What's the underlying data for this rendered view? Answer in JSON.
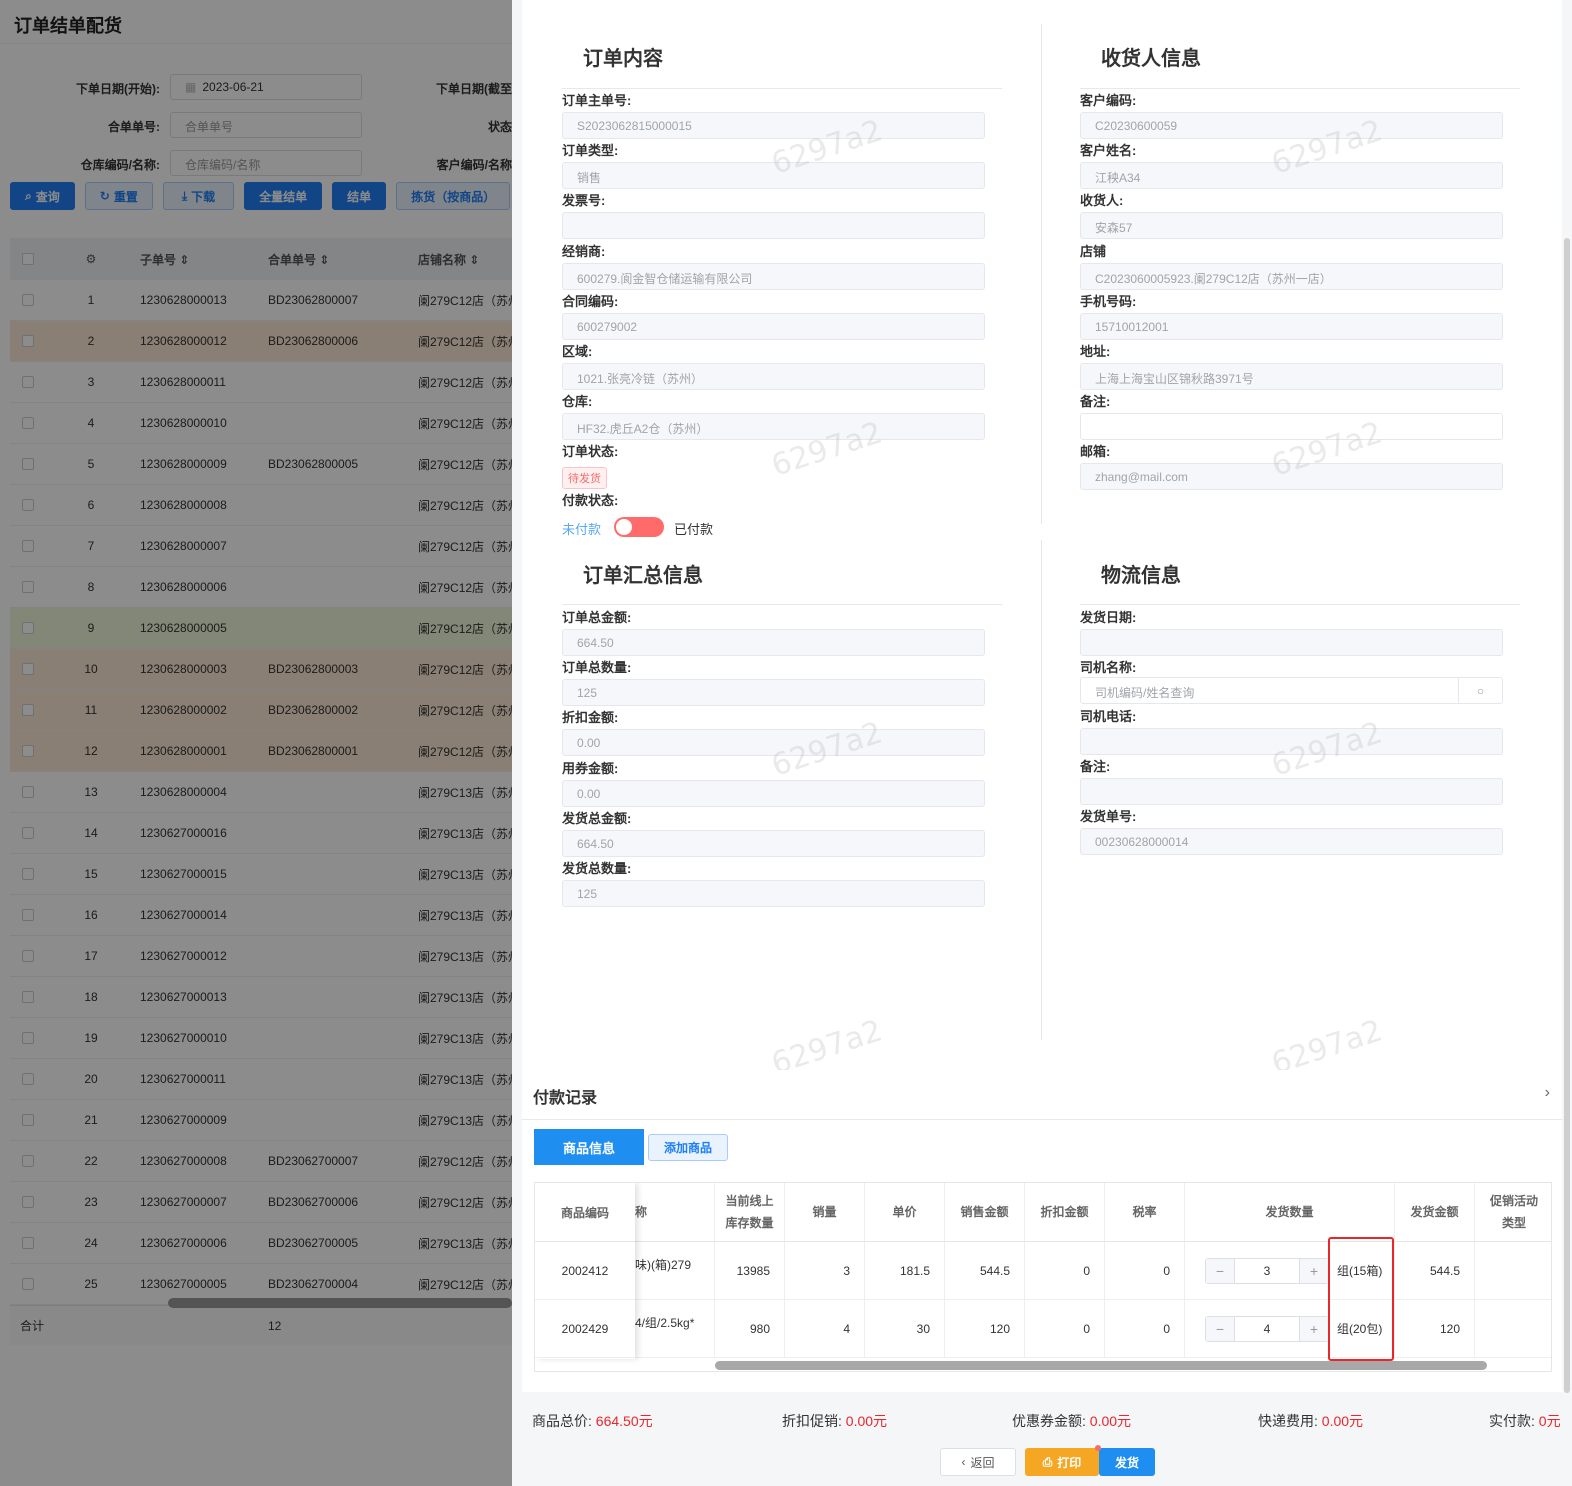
{
  "bg": {
    "title": "订单结单配货",
    "filters": {
      "start_label": "下单日期(开始):",
      "start_value": "2023-06-21",
      "end_label": "下单日期(截至",
      "merge_label": "合单单号:",
      "merge_placeholder": "合单单号",
      "status_label": "状态",
      "warehouse_label": "仓库编码/名称:",
      "warehouse_placeholder": "仓库编码/名称",
      "customer_label": "客户编码/名称"
    },
    "buttons": {
      "query": "查询",
      "reset": "重置",
      "download": "下载",
      "all_close": "全量结单",
      "close": "结单",
      "pick": "拣货（按商品）"
    },
    "columns": {
      "sub_no": "子单号",
      "merge_no": "合单单号",
      "shop": "店铺名称"
    },
    "rows": [
      {
        "idx": "1",
        "no": "1230628000013",
        "merge": "BD23062800007",
        "shop": "阑279C12店（苏州",
        "hl": ""
      },
      {
        "idx": "2",
        "no": "1230628000012",
        "merge": "BD23062800006",
        "shop": "阑279C12店（苏州",
        "hl": "o"
      },
      {
        "idx": "3",
        "no": "1230628000011",
        "merge": "",
        "shop": "阑279C12店（苏州",
        "hl": ""
      },
      {
        "idx": "4",
        "no": "1230628000010",
        "merge": "",
        "shop": "阑279C12店（苏州",
        "hl": ""
      },
      {
        "idx": "5",
        "no": "1230628000009",
        "merge": "BD23062800005",
        "shop": "阑279C12店（苏州",
        "hl": ""
      },
      {
        "idx": "6",
        "no": "1230628000008",
        "merge": "",
        "shop": "阑279C12店（苏州",
        "hl": ""
      },
      {
        "idx": "7",
        "no": "1230628000007",
        "merge": "",
        "shop": "阑279C12店（苏州",
        "hl": ""
      },
      {
        "idx": "8",
        "no": "1230628000006",
        "merge": "",
        "shop": "阑279C12店（苏州",
        "hl": ""
      },
      {
        "idx": "9",
        "no": "1230628000005",
        "merge": "",
        "shop": "阑279C12店（苏州",
        "hl": "g"
      },
      {
        "idx": "10",
        "no": "1230628000003",
        "merge": "BD23062800003",
        "shop": "阑279C12店（苏州",
        "hl": "o"
      },
      {
        "idx": "11",
        "no": "1230628000002",
        "merge": "BD23062800002",
        "shop": "阑279C12店（苏州",
        "hl": "o"
      },
      {
        "idx": "12",
        "no": "1230628000001",
        "merge": "BD23062800001",
        "shop": "阑279C12店（苏州",
        "hl": "o"
      },
      {
        "idx": "13",
        "no": "1230628000004",
        "merge": "",
        "shop": "阑279C13店（苏州",
        "hl": ""
      },
      {
        "idx": "14",
        "no": "1230627000016",
        "merge": "",
        "shop": "阑279C13店（苏州",
        "hl": ""
      },
      {
        "idx": "15",
        "no": "1230627000015",
        "merge": "",
        "shop": "阑279C13店（苏州",
        "hl": ""
      },
      {
        "idx": "16",
        "no": "1230627000014",
        "merge": "",
        "shop": "阑279C13店（苏州",
        "hl": ""
      },
      {
        "idx": "17",
        "no": "1230627000012",
        "merge": "",
        "shop": "阑279C13店（苏州",
        "hl": ""
      },
      {
        "idx": "18",
        "no": "1230627000013",
        "merge": "",
        "shop": "阑279C13店（苏州",
        "hl": ""
      },
      {
        "idx": "19",
        "no": "1230627000010",
        "merge": "",
        "shop": "阑279C13店（苏州",
        "hl": ""
      },
      {
        "idx": "20",
        "no": "1230627000011",
        "merge": "",
        "shop": "阑279C13店（苏州",
        "hl": ""
      },
      {
        "idx": "21",
        "no": "1230627000009",
        "merge": "",
        "shop": "阑279C13店（苏州",
        "hl": ""
      },
      {
        "idx": "22",
        "no": "1230627000008",
        "merge": "BD23062700007",
        "shop": "阑279C12店（苏州",
        "hl": ""
      },
      {
        "idx": "23",
        "no": "1230627000007",
        "merge": "BD23062700006",
        "shop": "阑279C12店（苏州",
        "hl": ""
      },
      {
        "idx": "24",
        "no": "1230627000006",
        "merge": "BD23062700005",
        "shop": "阑279C13店（苏州",
        "hl": ""
      },
      {
        "idx": "25",
        "no": "1230627000005",
        "merge": "BD23062700004",
        "shop": "阑279C12店（苏州",
        "hl": ""
      }
    ],
    "total_label": "合计",
    "total_value": "12"
  },
  "watermark": "6297a2",
  "order": {
    "title": "订单内容",
    "fields": [
      {
        "label": "订单主单号:",
        "value": "S2023062815000015"
      },
      {
        "label": "订单类型:",
        "value": "销售"
      },
      {
        "label": "发票号:",
        "value": ""
      },
      {
        "label": "经销商:",
        "value": "600279.阆金智仓储运输有限公司"
      },
      {
        "label": "合同编码:",
        "value": "600279002"
      },
      {
        "label": "区域:",
        "value": "1021.张亮冷链（苏州）"
      },
      {
        "label": "仓库:",
        "value": "HF32.虎丘A2仓（苏州）"
      }
    ],
    "status_label": "订单状态:",
    "status_tag": "待发货",
    "pay_label": "付款状态:",
    "pay_unpaid": "未付款",
    "pay_paid": "已付款"
  },
  "consignee": {
    "title": "收货人信息",
    "fields": [
      {
        "label": "客户编码:",
        "value": "C20230600059"
      },
      {
        "label": "客户姓名:",
        "value": "江秧A34"
      },
      {
        "label": "收货人:",
        "value": "安森57"
      },
      {
        "label": "店铺",
        "value": "C2023060005923.阑279C12店（苏州一店）"
      },
      {
        "label": "手机号码:",
        "value": "15710012001"
      },
      {
        "label": "地址:",
        "value": "上海上海宝山区锦秋路3971号"
      },
      {
        "label": "备注:",
        "value": ""
      },
      {
        "label": "邮箱:",
        "value": "zhang@mail.com"
      }
    ]
  },
  "summary": {
    "title": "订单汇总信息",
    "fields": [
      {
        "label": "订单总金额:",
        "value": "664.50"
      },
      {
        "label": "订单总数量:",
        "value": "125"
      },
      {
        "label": "折扣金额:",
        "value": "0.00"
      },
      {
        "label": "用券金额:",
        "value": "0.00"
      },
      {
        "label": "发货总金额:",
        "value": "664.50"
      },
      {
        "label": "发货总数量:",
        "value": "125"
      }
    ]
  },
  "logistics": {
    "title": "物流信息",
    "date_label": "发货日期:",
    "date_value": "",
    "driver_label": "司机名称:",
    "driver_placeholder": "司机编码/姓名查询",
    "phone_label": "司机电话:",
    "phone_value": "",
    "remark_label": "备注:",
    "remark_value": "",
    "ship_no_label": "发货单号:",
    "ship_no_value": "00230628000014"
  },
  "payment_record": {
    "title": "付款记录"
  },
  "goods": {
    "tab_active": "商品信息",
    "tab_add": "添加商品",
    "headers": {
      "code": "商品编码",
      "name_tail": "称",
      "stock_l1": "当前线上",
      "stock_l2": "库存数量",
      "sales": "销量",
      "price": "单价",
      "amount": "销售金额",
      "discount": "折扣金额",
      "tax": "税率",
      "ship_qty": "发货数量",
      "ship_amt": "发货金额",
      "promo_l1": "促销活动",
      "promo_l2": "类型"
    },
    "rows": [
      {
        "code": "2002412",
        "name": "味)(箱)279",
        "stock": "13985",
        "sales": "3",
        "price": "181.5",
        "amount": "544.5",
        "discount": "0",
        "tax": "0",
        "qty": "3",
        "unit": "组(15箱)",
        "ship_amt": "544.5",
        "promo": ""
      },
      {
        "code": "2002429",
        "name": "4/组/2.5kg*",
        "stock": "980",
        "sales": "4",
        "price": "30",
        "amount": "120",
        "discount": "0",
        "tax": "0",
        "qty": "4",
        "unit": "组(20包)",
        "ship_amt": "120",
        "promo": ""
      }
    ]
  },
  "totals": {
    "goods_label": "商品总价:",
    "goods_value": "664.50元",
    "discount_label": "折扣促销:",
    "discount_value": "0.00元",
    "coupon_label": "优惠券金额:",
    "coupon_value": "0.00元",
    "express_label": "快递费用:",
    "express_value": "0.00元",
    "paid_label": "实付款:",
    "paid_value": "0元"
  },
  "footer": {
    "back": "返回",
    "print": "打印",
    "ship": "发货"
  },
  "colors": {
    "primary": "#1f8ef1",
    "danger": "#e8262b",
    "warning": "#f5a623"
  }
}
